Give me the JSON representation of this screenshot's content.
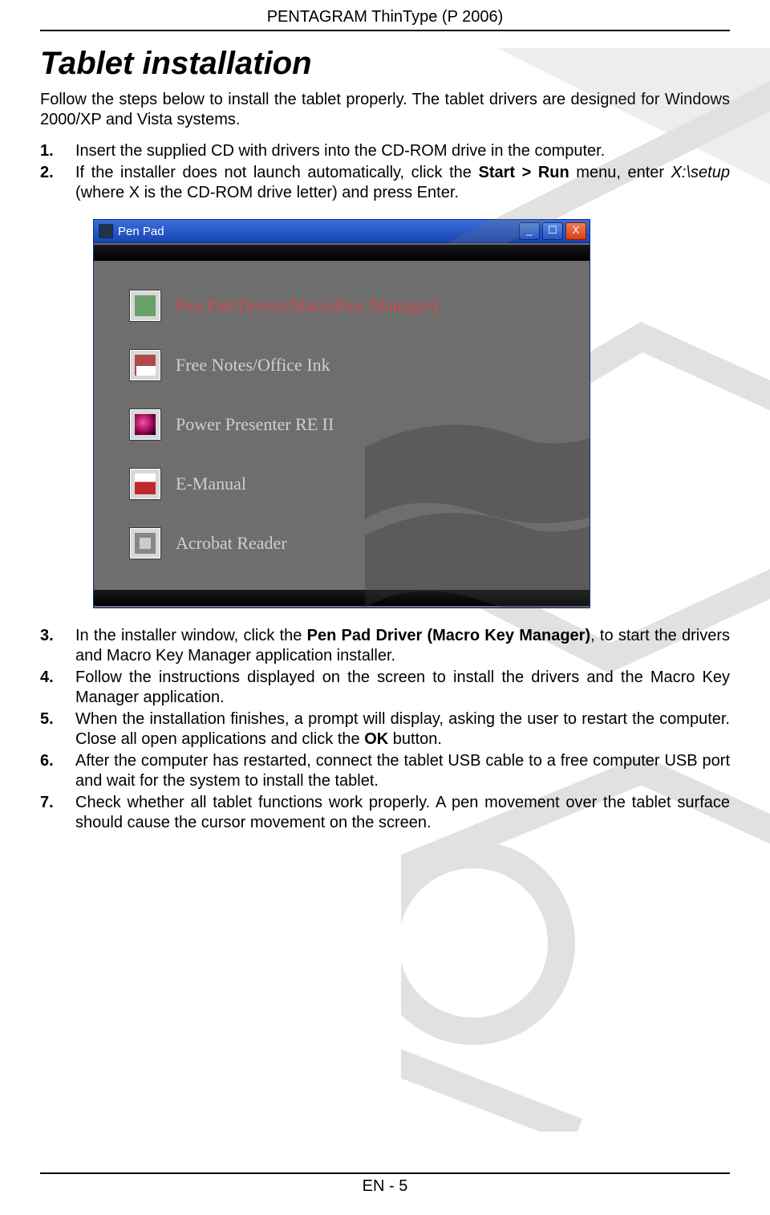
{
  "header": {
    "product_line": "PENTAGRAM ThinType (P 2006)"
  },
  "title": "Tablet installation",
  "intro": "Follow the steps below to install the tablet properly. The tablet drivers are designed for Windows 2000/XP and Vista systems.",
  "steps_a": [
    {
      "plain": "Insert the supplied CD with drivers into the CD-ROM drive in the computer."
    },
    {
      "pre": "If the installer does not launch automatically, click the ",
      "bold1": "Start > Run",
      "mid": " menu, enter ",
      "ital": "X:\\setup",
      "post": " (where X is the CD-ROM drive letter) and press Enter."
    }
  ],
  "installer": {
    "titlebar": {
      "title": "Pen Pad",
      "min": "_",
      "max": "☐",
      "close": "X"
    },
    "items": [
      "Pen Pad Driver(MacroKey Manager)",
      "Free Notes/Office Ink",
      "Power Presenter RE II",
      "E-Manual",
      "Acrobat Reader"
    ]
  },
  "steps_b": [
    {
      "pre": "In the installer window, click the ",
      "bold1": "Pen Pad Driver (Macro Key Manager)",
      "post": ", to start the drivers and Macro Key Manager application installer."
    },
    {
      "plain": "Follow the instructions displayed on the screen to install the drivers and the Macro Key Manager application."
    },
    {
      "pre": "When the installation finishes, a prompt will display, asking the user to restart the computer. Close all open applications and click the ",
      "bold1": "OK",
      "post": " button."
    },
    {
      "plain": "After the computer has restarted, connect the tablet USB cable to a free computer USB port and wait for the system to install the tablet."
    },
    {
      "plain": "Check whether all tablet functions work properly. A pen movement over the tablet surface should cause the cursor movement on the screen."
    }
  ],
  "footer": {
    "page": "EN - 5"
  }
}
